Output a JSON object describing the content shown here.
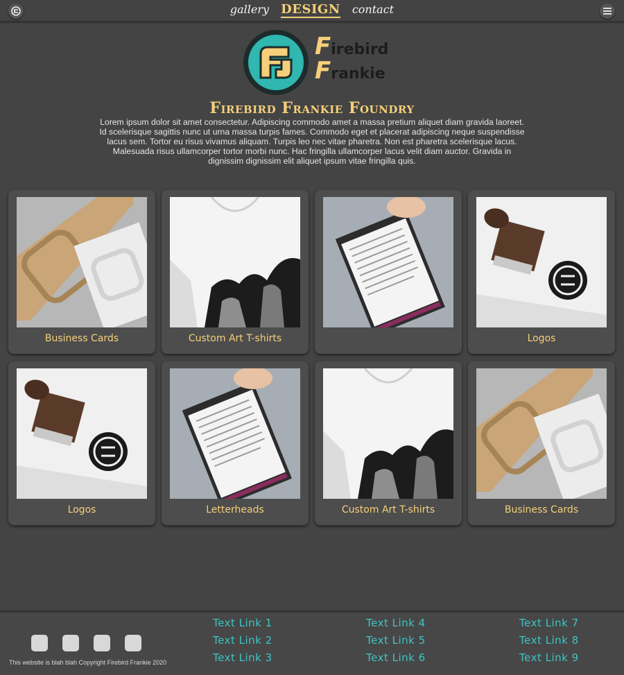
{
  "nav": {
    "links": [
      "gallery",
      "DESIGN",
      "contact"
    ],
    "active": "DESIGN"
  },
  "brand": {
    "line1_cap": "F",
    "line1_rest": "irebird",
    "line2_cap": "F",
    "line2_rest": "rankie"
  },
  "hero": {
    "title": "Firebird Frankie Foundry",
    "description": "Lorem ipsum dolor sit amet consectetur. Adipiscing commodo amet a massa pretium aliquet diam gravida laoreet. Id scelerisque sagittis nunc ut urna massa turpis fames. Commodo eget et placerat adipiscing neque suspendisse lacus sem. Tortor eu risus vivamus aliquam. Turpis leo nec vitae pharetra. Non est pharetra scelerisque lacus. Malesuada risus ullamcorper tortor morbi nunc. Hac fringilla ullamcorper lacus velit diam auctor. Gravida in dignissim dignissim elit aliquet ipsum vitae fringilla quis."
  },
  "cards": [
    {
      "label": "Business Cards",
      "image": "business-card-mockup"
    },
    {
      "label": "Custom Art T-shirts",
      "image": "tshirt-mockup"
    },
    {
      "label": "",
      "image": "letterhead-mockup"
    },
    {
      "label": "Logos",
      "image": "stamp-mockup"
    },
    {
      "label": "Logos",
      "image": "stamp-mockup"
    },
    {
      "label": "Letterheads",
      "image": "letterhead-mockup"
    },
    {
      "label": "Custom Art T-shirts",
      "image": "tshirt-mockup"
    },
    {
      "label": "Business Cards",
      "image": "business-card-mockup"
    }
  ],
  "footer": {
    "copyright": "This website is blah blah Copyright Firebird Frankie 2020",
    "links": [
      "Text Link 1",
      "Text Link 2",
      "Text Link 3",
      "Text Link 4",
      "Text Link 5",
      "Text Link 6",
      "Text Link 7",
      "Text Link 8",
      "Text Link 9"
    ],
    "social_icons": [
      "social-icon-1",
      "social-icon-2",
      "social-icon-3",
      "social-icon-4"
    ]
  },
  "colors": {
    "accent": "#f6cf7a",
    "teal": "#3fc4c4",
    "background": "#444444"
  }
}
